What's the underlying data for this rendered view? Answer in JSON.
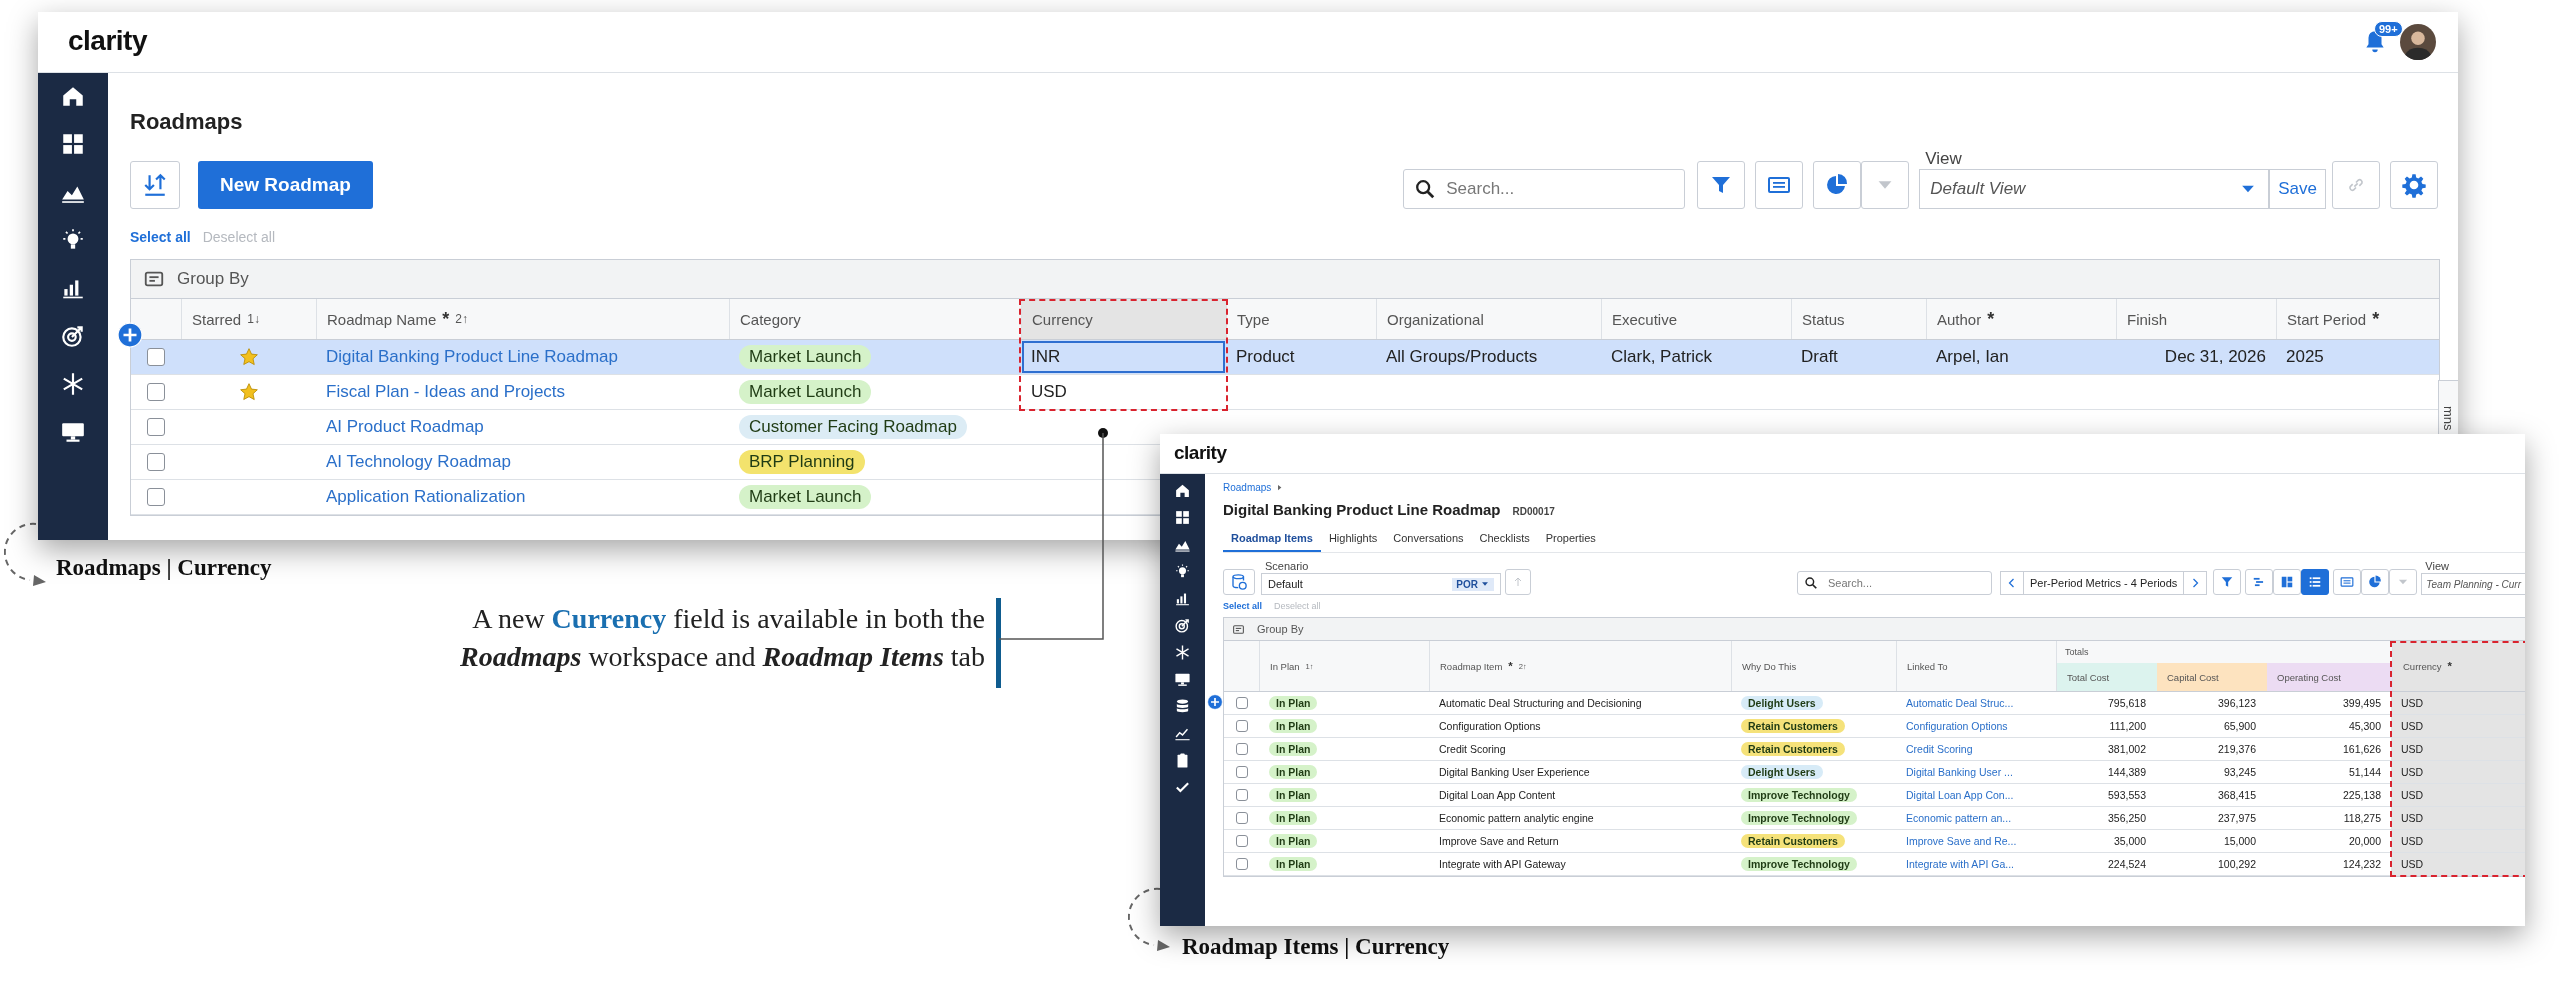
{
  "roadmaps_window": {
    "logo": "clarity",
    "notification_badge": "99+",
    "title": "Roadmaps",
    "new_button": "New Roadmap",
    "search": {
      "placeholder": "Search..."
    },
    "view": {
      "label": "View",
      "value": "Default View"
    },
    "save_button": "Save",
    "select_all": "Select all",
    "deselect_all": "Deselect all",
    "group_by": "Group By",
    "columns": [
      {
        "label": "Starred",
        "sort": "1↓",
        "kind": "star"
      },
      {
        "label": "Roadmap Name",
        "mark": "*",
        "sort": "2↑",
        "kind": "link"
      },
      {
        "label": "Category",
        "kind": "tag"
      },
      {
        "label": "Currency",
        "kind": "text",
        "highlighted": true
      },
      {
        "label": "Type",
        "kind": "text"
      },
      {
        "label": "Organizational",
        "kind": "text"
      },
      {
        "label": "Executive",
        "kind": "text"
      },
      {
        "label": "Status",
        "kind": "text"
      },
      {
        "label": "Author",
        "mark": "*",
        "kind": "text"
      },
      {
        "label": "Finish",
        "kind": "date"
      },
      {
        "label": "Start Period",
        "mark": "*",
        "kind": "text"
      }
    ],
    "rows": [
      {
        "selected": true,
        "checked": false,
        "cells": [
          {
            "starred": true
          },
          "Digital Banking Product Line Roadmap",
          {
            "text": "Market Launch",
            "color": "#d5f2c9"
          },
          "INR",
          "Product",
          "All Groups/Products",
          "Clark, Patrick",
          "Draft",
          "Arpel, Ian",
          "Dec 31, 2026",
          "2025"
        ]
      },
      {
        "selected": false,
        "checked": false,
        "cells": [
          {
            "starred": true
          },
          "Fiscal Plan - Ideas and Projects",
          {
            "text": "Market Launch",
            "color": "#d5f2c9"
          },
          "USD"
        ]
      },
      {
        "selected": false,
        "checked": false,
        "cells": [
          {
            "starred": false
          },
          "AI Product Roadmap",
          {
            "text": "Customer Facing Roadmap",
            "color": "#dcecf5"
          }
        ]
      },
      {
        "selected": false,
        "checked": false,
        "cells": [
          {
            "starred": false
          },
          "AI Technology Roadmap",
          {
            "text": "BRP Planning",
            "color": "#f3e36d"
          }
        ]
      },
      {
        "selected": false,
        "checked": false,
        "cells": [
          {
            "starred": false
          },
          "Application Rationalization",
          {
            "text": "Market Launch",
            "color": "#d5f2c9"
          }
        ]
      }
    ],
    "side_tab": "mns"
  },
  "items_window": {
    "logo": "clarity",
    "breadcrumb": "Roadmaps",
    "title": "Digital Banking Product Line Roadmap",
    "code": "RD00017",
    "tabs": [
      {
        "label": "Roadmap Items",
        "selected": true
      },
      {
        "label": "Highlights",
        "selected": false
      },
      {
        "label": "Conversations",
        "selected": false
      },
      {
        "label": "Checklists",
        "selected": false
      },
      {
        "label": "Properties",
        "selected": false
      }
    ],
    "scenario": {
      "label": "Scenario",
      "value": "Default",
      "badge": "POR"
    },
    "search": {
      "placeholder": "Search..."
    },
    "period": "Per-Period Metrics - 4 Periods",
    "view": {
      "label": "View",
      "value": "Team Planning - Curr"
    },
    "select_all": "Select all",
    "deselect_all": "Deselect all",
    "group_by": "Group By",
    "totals_label": "Totals",
    "columns": [
      {
        "label": "In Plan",
        "sort": "1↑",
        "kind": "tag"
      },
      {
        "label": "Roadmap Item",
        "mark": "*",
        "sort": "2↑",
        "kind": "text"
      },
      {
        "label": "Why Do This",
        "kind": "tag"
      },
      {
        "label": "Linked To",
        "kind": "link"
      },
      {
        "label": "Total Cost",
        "kind": "number",
        "in_totals": true,
        "color": "#dcf3ee"
      },
      {
        "label": "Capital Cost",
        "kind": "number",
        "in_totals": true,
        "color": "#fde3bf"
      },
      {
        "label": "Operating Cost",
        "kind": "number",
        "in_totals": true,
        "color": "#ecdcf3"
      },
      {
        "label": "Currency",
        "mark": "*",
        "kind": "text",
        "highlighted": true
      }
    ],
    "rows": [
      {
        "selected": false,
        "checked": false,
        "cells": [
          {
            "text": "In Plan",
            "color": "#d5f2c9"
          },
          "Automatic Deal Structuring and Decisioning",
          {
            "text": "Delight Users",
            "color": "#d7ebf7"
          },
          "Automatic Deal Struc...",
          "795,618",
          "396,123",
          "399,495",
          "USD"
        ]
      },
      {
        "selected": false,
        "checked": false,
        "cells": [
          {
            "text": "In Plan",
            "color": "#d5f2c9"
          },
          "Configuration Options",
          {
            "text": "Retain Customers",
            "color": "#f5e27a"
          },
          "Configuration Options",
          "111,200",
          "65,900",
          "45,300",
          "USD"
        ]
      },
      {
        "selected": false,
        "checked": false,
        "cells": [
          {
            "text": "In Plan",
            "color": "#d5f2c9"
          },
          "Credit Scoring",
          {
            "text": "Retain Customers",
            "color": "#f5e27a"
          },
          "Credit Scoring",
          "381,002",
          "219,376",
          "161,626",
          "USD"
        ]
      },
      {
        "selected": false,
        "checked": false,
        "cells": [
          {
            "text": "In Plan",
            "color": "#d5f2c9"
          },
          "Digital Banking User Experience",
          {
            "text": "Delight Users",
            "color": "#d7ebf7"
          },
          "Digital Banking User ...",
          "144,389",
          "93,245",
          "51,144",
          "USD"
        ]
      },
      {
        "selected": false,
        "checked": false,
        "cells": [
          {
            "text": "In Plan",
            "color": "#d5f2c9"
          },
          "Digital Loan App Content",
          {
            "text": "Improve Technology",
            "color": "#d5f2c9"
          },
          "Digital Loan App Con...",
          "593,553",
          "368,415",
          "225,138",
          "USD"
        ]
      },
      {
        "selected": false,
        "checked": false,
        "cells": [
          {
            "text": "In Plan",
            "color": "#d5f2c9"
          },
          "Economic pattern analytic engine",
          {
            "text": "Improve Technology",
            "color": "#d5f2c9"
          },
          "Economic pattern an...",
          "356,250",
          "237,975",
          "118,275",
          "USD"
        ]
      },
      {
        "selected": false,
        "checked": false,
        "cells": [
          {
            "text": "In Plan",
            "color": "#d5f2c9"
          },
          "Improve Save and Return",
          {
            "text": "Retain Customers",
            "color": "#f5e27a"
          },
          "Improve Save and Re...",
          "35,000",
          "15,000",
          "20,000",
          "USD"
        ]
      },
      {
        "selected": false,
        "checked": false,
        "cells": [
          {
            "text": "In Plan",
            "color": "#d5f2c9"
          },
          "Integrate with API Gateway",
          {
            "text": "Improve Technology",
            "color": "#d5f2c9"
          },
          "Integrate with API Ga...",
          "224,524",
          "100,292",
          "124,232",
          "USD"
        ]
      }
    ]
  },
  "annotations": {
    "labels": [
      "Roadmaps | Currency",
      "Roadmap Items | Currency"
    ],
    "callout": "A new **Currency** field is available in both the *Roadmaps* workspace and *Roadmap Items* tab"
  }
}
